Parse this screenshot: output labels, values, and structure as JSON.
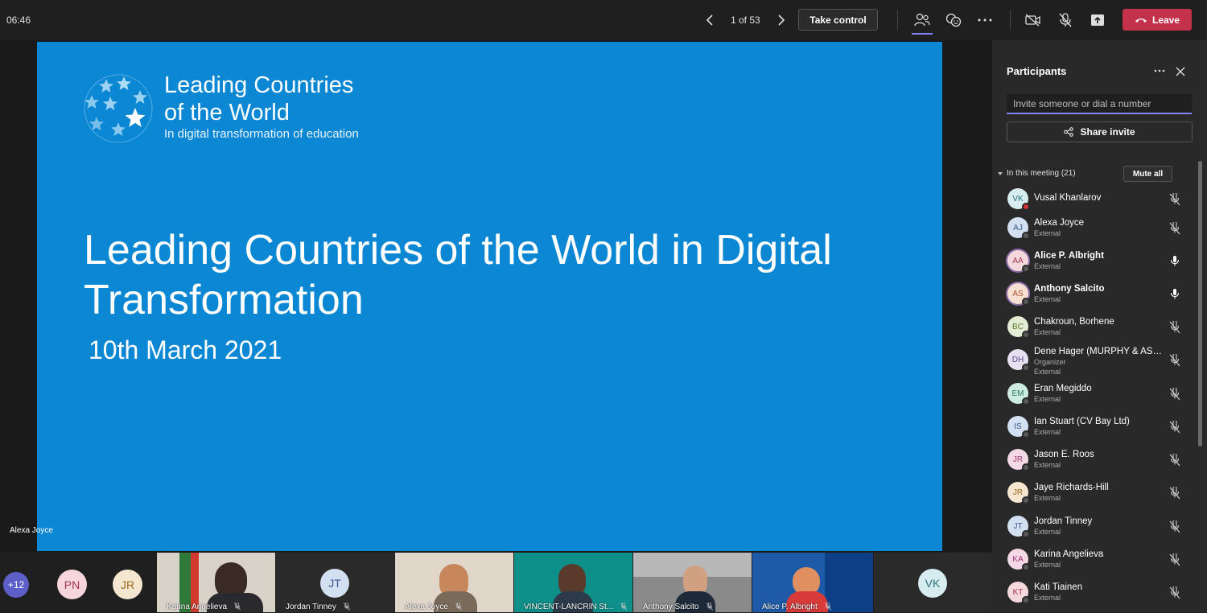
{
  "topbar": {
    "time": "06:46",
    "page_indicator": "1 of 53",
    "take_control": "Take control",
    "leave": "Leave"
  },
  "slide": {
    "brand_line1": "Leading Countries",
    "brand_line2": "of the World",
    "brand_tagline": "In digital transformation of education",
    "title": "Leading Countries of the World in Digital Transformation",
    "date": "10th March 2021",
    "presenter": "Alexa Joyce"
  },
  "strip": {
    "more_count": "+12",
    "avatars": [
      "PN",
      "JR",
      "JT",
      "VK"
    ],
    "tiles": [
      {
        "name": "Karina Angelieva"
      },
      {
        "name": "Jordan Tinney"
      },
      {
        "name": "Alexa Joyce"
      },
      {
        "name": "VINCENT-LANCRIN St..."
      },
      {
        "name": "Anthony Salcito"
      },
      {
        "name": "Alice P. Albright"
      }
    ]
  },
  "panel": {
    "title": "Participants",
    "invite_placeholder": "Invite someone or dial a number",
    "share_invite": "Share invite",
    "in_meeting": "In this meeting (21)",
    "mute_all": "Mute all",
    "participants": [
      {
        "initials": "VK",
        "name": "Vusal Khanlarov",
        "sub": "",
        "sub2": "",
        "color": "#d6ecef",
        "tcolor": "#2a6f7a",
        "bold": false,
        "mic": "muted"
      },
      {
        "initials": "AJ",
        "name": "Alexa Joyce",
        "sub": "External",
        "sub2": "",
        "color": "#d3e0f2",
        "tcolor": "#3a5a8c",
        "bold": false,
        "mic": "muted"
      },
      {
        "initials": "AA",
        "name": "Alice P. Albright",
        "sub": "External",
        "sub2": "",
        "color": "#f4d8dc",
        "tcolor": "#a4374b",
        "bold": true,
        "mic": "on"
      },
      {
        "initials": "AS",
        "name": "Anthony Salcito",
        "sub": "External",
        "sub2": "",
        "color": "#f7dfd2",
        "tcolor": "#b2532b",
        "bold": true,
        "mic": "on"
      },
      {
        "initials": "BC",
        "name": "Chakroun, Borhene",
        "sub": "External",
        "sub2": "",
        "color": "#e3edd3",
        "tcolor": "#5b7a2a",
        "bold": false,
        "mic": "muted"
      },
      {
        "initials": "DH",
        "name": "Dene Hager (MURPHY & ASS...",
        "sub": "Organizer",
        "sub2": "External",
        "color": "#e6e0f0",
        "tcolor": "#5b4a8a",
        "bold": false,
        "mic": "muted"
      },
      {
        "initials": "EM",
        "name": "Eran Megiddo",
        "sub": "External",
        "sub2": "",
        "color": "#cdebe0",
        "tcolor": "#2a7a5a",
        "bold": false,
        "mic": "muted"
      },
      {
        "initials": "IS",
        "name": "Ian Stuart (CV Bay Ltd)",
        "sub": "External",
        "sub2": "",
        "color": "#d3e0f2",
        "tcolor": "#3a5a8c",
        "bold": false,
        "mic": "muted"
      },
      {
        "initials": "JR",
        "name": "Jason E. Roos",
        "sub": "External",
        "sub2": "",
        "color": "#f4d8e6",
        "tcolor": "#a4376f",
        "bold": false,
        "mic": "muted"
      },
      {
        "initials": "JR",
        "name": "Jaye Richards-Hill",
        "sub": "External",
        "sub2": "",
        "color": "#f5e6cf",
        "tcolor": "#9a6a1f",
        "bold": false,
        "mic": "muted"
      },
      {
        "initials": "JT",
        "name": "Jordan Tinney",
        "sub": "External",
        "sub2": "",
        "color": "#d3e0f2",
        "tcolor": "#3a5a8c",
        "bold": false,
        "mic": "muted"
      },
      {
        "initials": "KA",
        "name": "Karina Angelieva",
        "sub": "External",
        "sub2": "",
        "color": "#f4d8e6",
        "tcolor": "#a4376f",
        "bold": false,
        "mic": "muted"
      },
      {
        "initials": "KT",
        "name": "Kati Tiainen",
        "sub": "External",
        "sub2": "",
        "color": "#f4d8dc",
        "tcolor": "#a4374b",
        "bold": false,
        "mic": "muted"
      }
    ]
  }
}
